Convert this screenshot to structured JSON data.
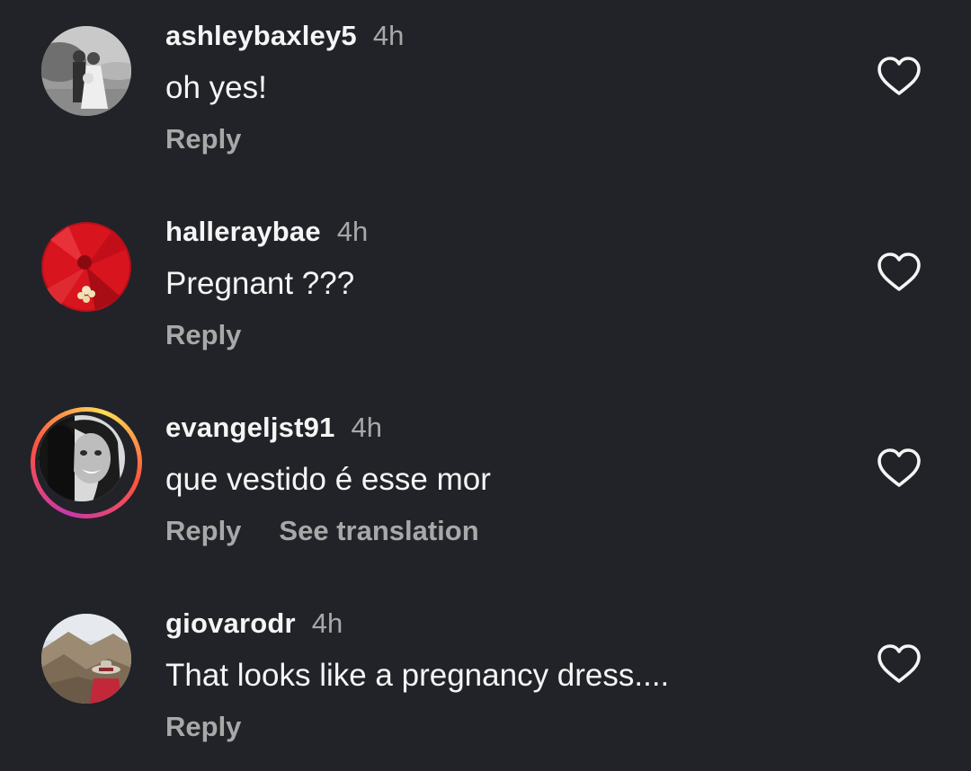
{
  "comments": [
    {
      "username": "ashleybaxley5",
      "time": "4h",
      "text": "oh yes!",
      "reply_label": "Reply",
      "avatar": "wedding-photo-avatar",
      "like_icon": "heart-outline-icon"
    },
    {
      "username": "halleraybae",
      "time": "4h",
      "text": "Pregnant ???",
      "reply_label": "Reply",
      "avatar": "red-flower-avatar",
      "like_icon": "heart-outline-icon"
    },
    {
      "username": "evangeljst91",
      "time": "4h",
      "text": "que vestido é esse mor",
      "reply_label": "Reply",
      "translate_label": "See translation",
      "avatar": "portrait-avatar-with-story-ring",
      "like_icon": "heart-outline-icon"
    },
    {
      "username": "giovarodr",
      "time": "4h",
      "text": "That looks like a pregnancy dress....",
      "reply_label": "Reply",
      "avatar": "mountain-hat-avatar",
      "like_icon": "heart-outline-icon"
    }
  ],
  "colors": {
    "background": "#212328",
    "primary_text": "#f5f5f5",
    "secondary_text": "#a8a8a8"
  }
}
